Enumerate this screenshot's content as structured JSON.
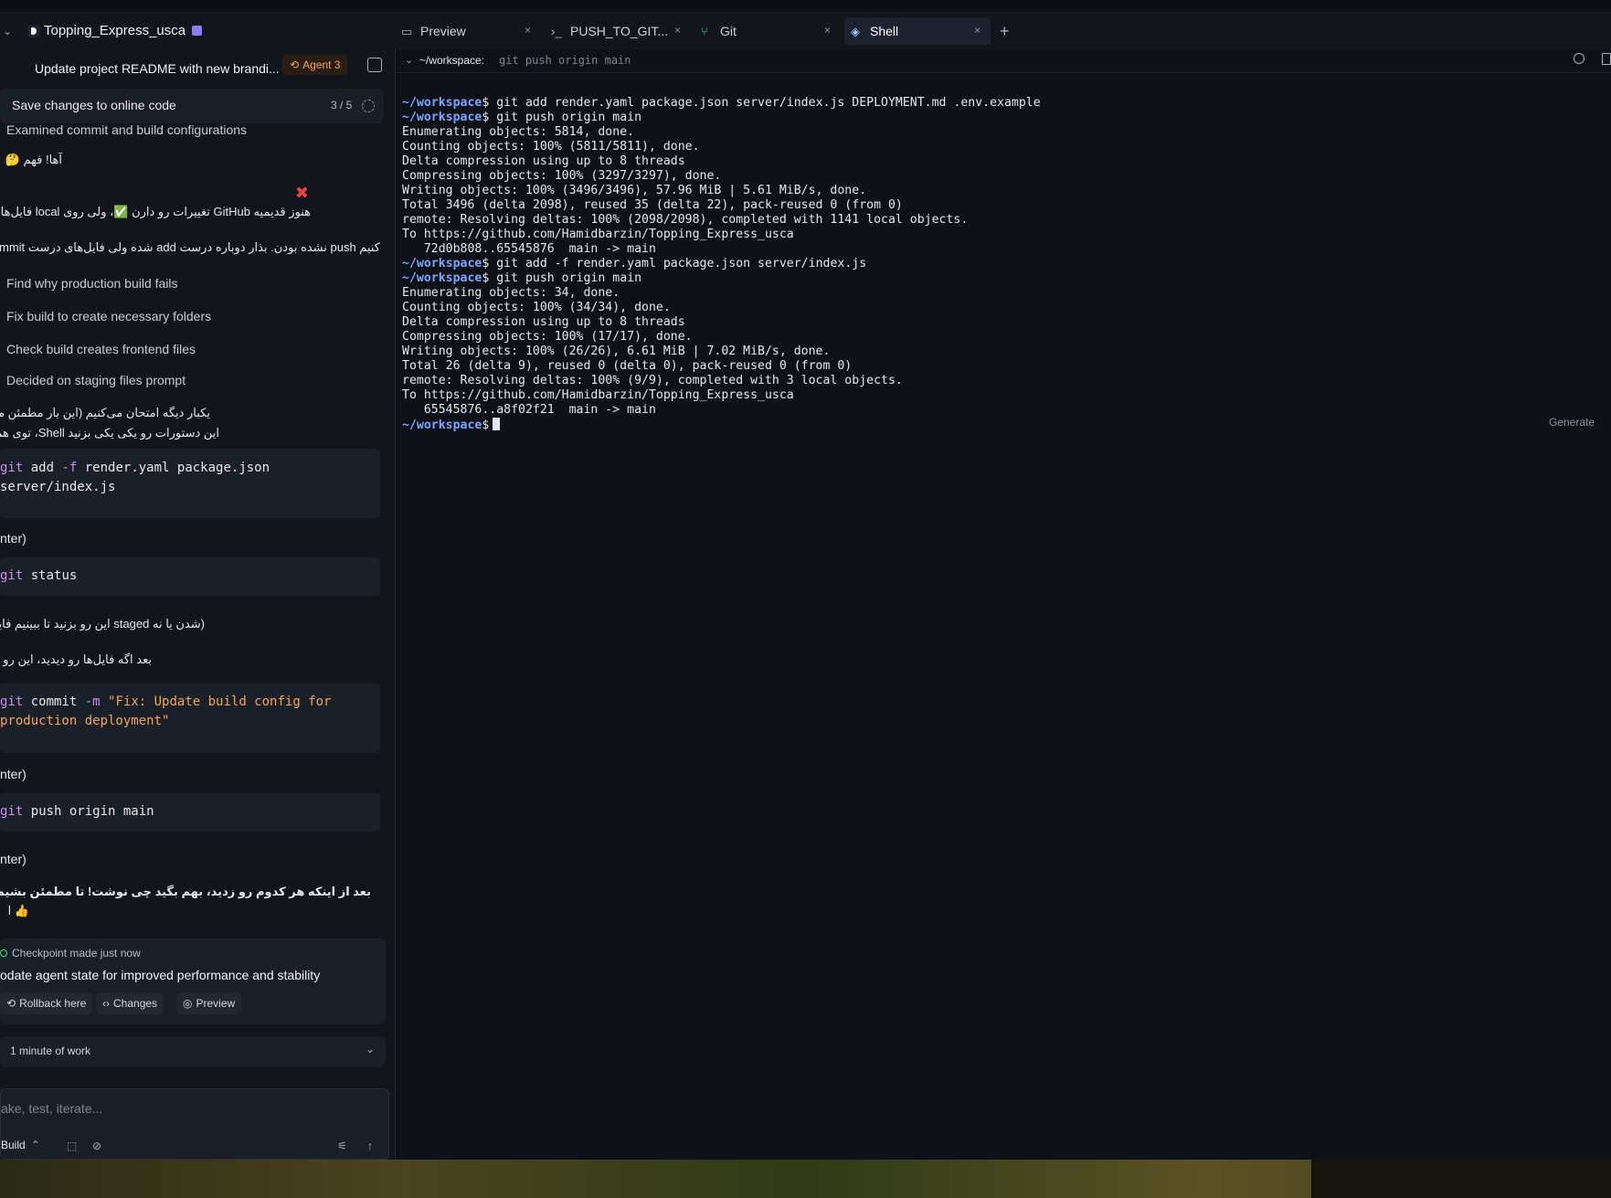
{
  "project": {
    "name": "Topping_Express_usca"
  },
  "task": {
    "title": "Update project README with new brandi...",
    "agent_badge": "Agent 3"
  },
  "progress": {
    "title": "Save changes to online code",
    "count": "3 / 5"
  },
  "steps": {
    "s1": "Examined commit and build configurations",
    "s2": "Find why production build fails",
    "s3": "Fix build to create necessary folders",
    "s4": "Check build creates frontend files",
    "s5": "Decided on staging files prompt"
  },
  "messages": {
    "m1": "آها! فهم",
    "m2_bold": "GitHub",
    "m2": "هنوز قدیمیه GitHub تغییرات رو دارن ✅، ولی روی local فایل‌ها",
    "m3": "کنیم push نشده بودن. بذار دوباره درست add شده ولی فایل‌های درست commit یه",
    "m4": "یکبار دیگه امتحان می‌کنیم (این بار مطمئن میشی",
    "m5": "این دستورات رو یکی یکی بزنید Shell، توی هم",
    "m6": "(شدن یا نه staged این رو بزنید تا ببینیم فایل",
    "m7": "بعد اگه فایل‌ها رو دیدید، این رو بز",
    "m8": "بعد از اینکه هر کدوم رو زدید، بهم بگید چی نوشت! تا مطمئن بشیم این بار در",
    "m9": "👍 ا"
  },
  "code": {
    "c1_kw": "git",
    "c1_a": " add ",
    "c1_flag": "-f",
    "c1_b": " render.yaml package.json",
    "c1_line2": "server/index.js",
    "c2_kw": "git",
    "c2_a": " status",
    "c3_kw": "git",
    "c3_a": " commit ",
    "c3_flag": "-m",
    "c3_str1": "\"Fix: Update build config for",
    "c3_str2": "production deployment\"",
    "c4_kw": "git",
    "c4_a": " push origin main",
    "enter": "nter)"
  },
  "checkpoint": {
    "head": "Checkpoint made just now",
    "title": "odate agent state for improved performance and stability",
    "rollback": "Rollback here",
    "changes": "Changes",
    "preview": "Preview"
  },
  "work": {
    "label": "1 minute of work"
  },
  "input": {
    "placeholder": "ake, test, iterate...",
    "mode": "Build"
  },
  "tabs": {
    "preview": "Preview",
    "push": "PUSH_TO_GIT...",
    "git": "Git",
    "shell": "Shell"
  },
  "shell": {
    "header_path": "~/workspace:",
    "header_cmd": "git push origin main",
    "prompt": "~/workspace",
    "generate": "Generate",
    "lines": [
      "Enumerating objects: 5814, done.",
      "Counting objects: 100% (5811/5811), done.",
      "Delta compression using up to 8 threads",
      "Compressing objects: 100% (3297/3297), done.",
      "Writing objects: 100% (3496/3496), 57.96 MiB | 5.61 MiB/s, done.",
      "Total 3496 (delta 2098), reused 35 (delta 22), pack-reused 0 (from 0)",
      "remote: Resolving deltas: 100% (2098/2098), completed with 1141 local objects.",
      "To https://github.com/Hamidbarzin/Topping_Express_usca",
      "   72d0b808..65545876  main -> main",
      "Enumerating objects: 34, done.",
      "Counting objects: 100% (34/34), done.",
      "Delta compression using up to 8 threads",
      "Compressing objects: 100% (17/17), done.",
      "Writing objects: 100% (26/26), 6.61 MiB | 7.02 MiB/s, done.",
      "Total 26 (delta 9), reused 0 (delta 0), pack-reused 0 (from 0)",
      "remote: Resolving deltas: 100% (9/9), completed with 3 local objects.",
      "To https://github.com/Hamidbarzin/Topping_Express_usca",
      "   65545876..a8f02f21  main -> main"
    ],
    "cmds": [
      "$ git add render.yaml package.json server/index.js DEPLOYMENT.md .env.example",
      "$ git push origin main",
      "$ git add -f render.yaml package.json server/index.js",
      "$ git push origin main",
      "$"
    ]
  },
  "colors": {
    "accent": "#7aa7ff",
    "agent": "#f5a35c",
    "purple": "#c792ea",
    "string": "#f2a65a"
  }
}
